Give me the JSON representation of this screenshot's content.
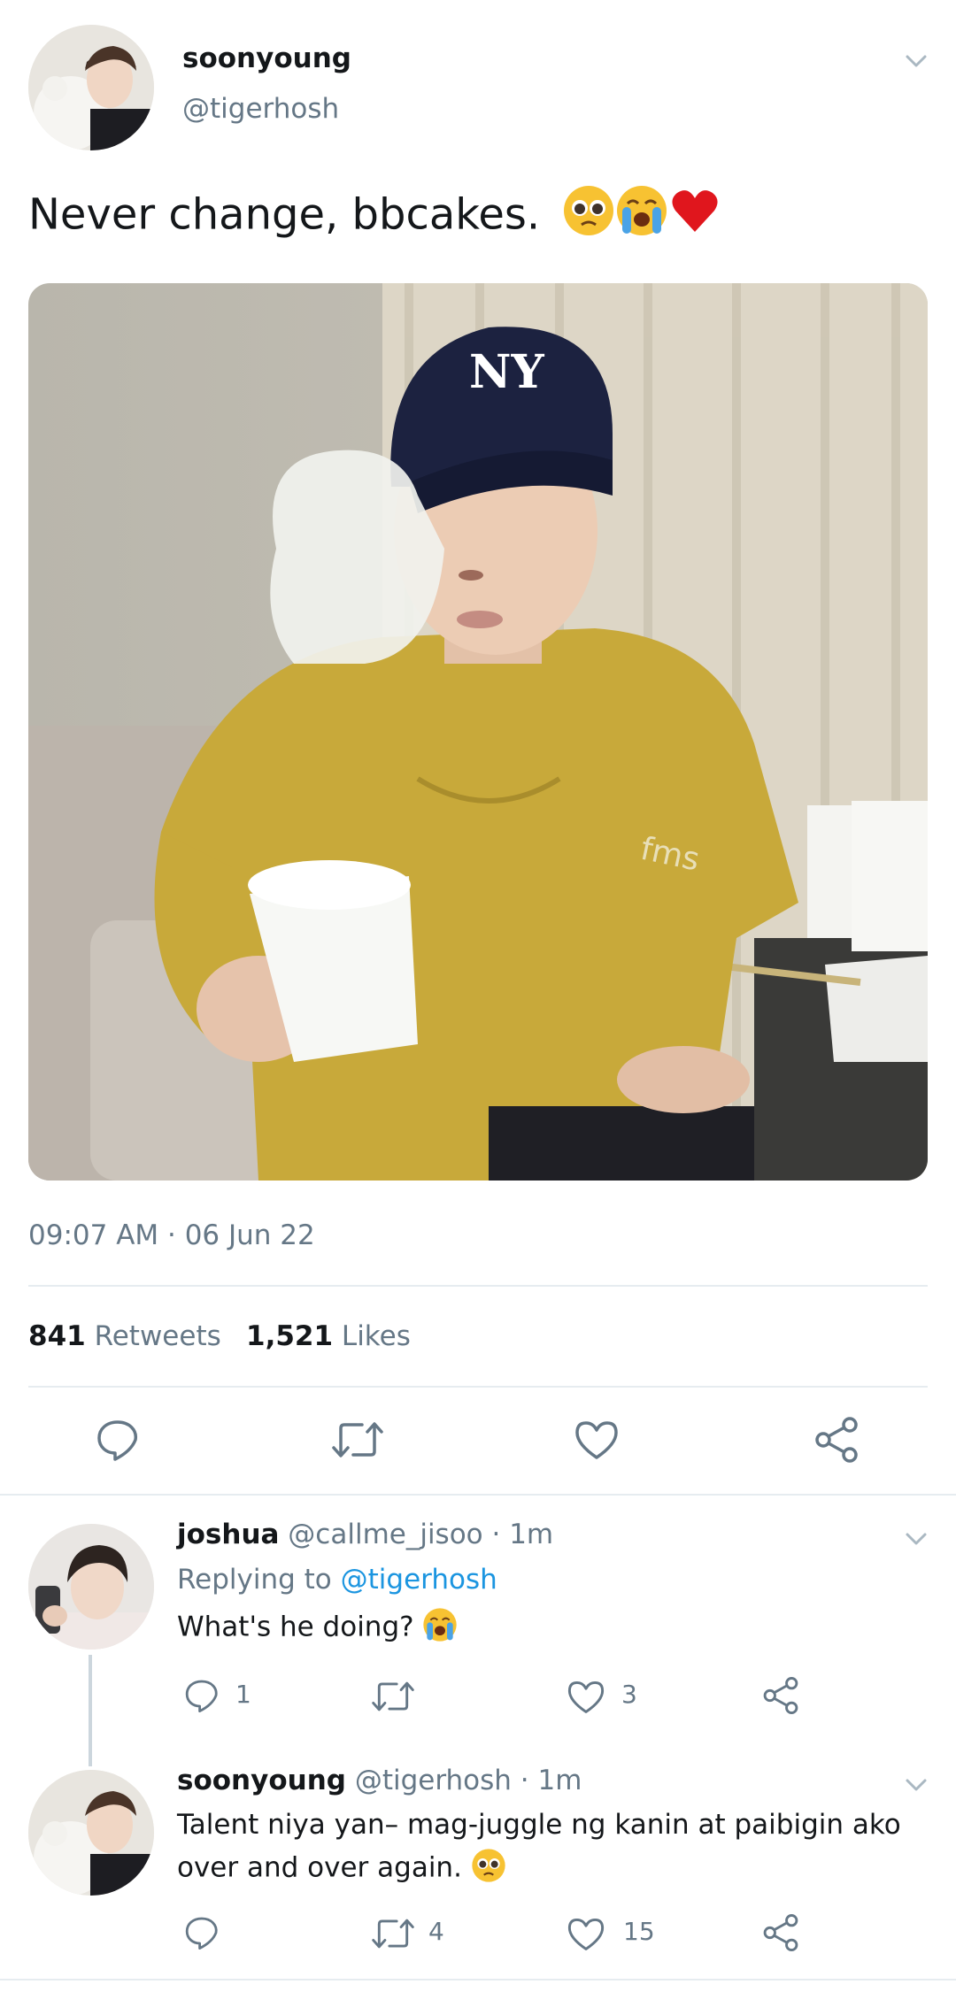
{
  "main_tweet": {
    "display_name": "soonyoung",
    "handle": "@tigerhosh",
    "text": "Never change, bbcakes.",
    "text_emojis": [
      "pleading-face-emoji",
      "loudly-crying-face-emoji",
      "red-heart-emoji"
    ],
    "media_description_icon": "photo",
    "cap_logo": "NY",
    "shirt_text": "fms",
    "timestamp": "09:07 AM · 06 Jun 22",
    "retweets_count": "841",
    "retweets_label": "Retweets",
    "likes_count": "1,521",
    "likes_label": "Likes"
  },
  "replies": [
    {
      "display_name": "joshua",
      "handle_time": "@callme_jisoo · 1m",
      "replying_prefix": "Replying to",
      "replying_to": "@tigerhosh",
      "text": "What's he doing?",
      "reply_count": "1",
      "retweet_count": "",
      "like_count": "3"
    },
    {
      "display_name": "soonyoung",
      "handle_time": "@tigerhosh · 1m",
      "text_line1": "Talent niya yan– mag-juggle ng kanin at paibigin ako",
      "text_line2": "over and over again.",
      "reply_count": "",
      "retweet_count": "4",
      "like_count": "15"
    }
  ],
  "colors": {
    "text": "#14171a",
    "muted": "#657786",
    "link": "#1b95e0",
    "divider": "#e6ecf0"
  }
}
